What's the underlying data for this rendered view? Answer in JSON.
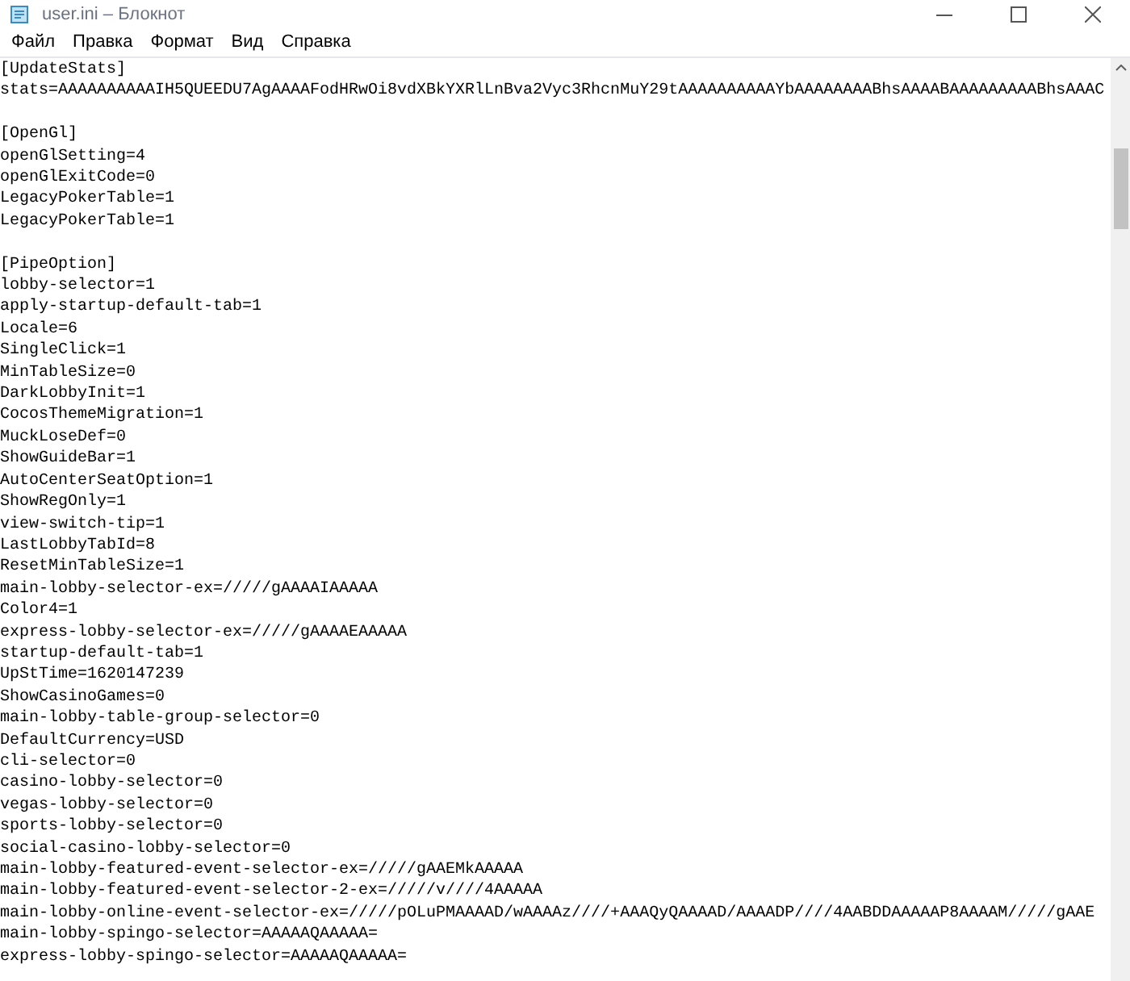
{
  "window": {
    "title": "user.ini – Блокнот"
  },
  "menu": [
    "Файл",
    "Правка",
    "Формат",
    "Вид",
    "Справка"
  ],
  "sections": [
    {
      "header": "[UpdateStats]",
      "lines": [
        "stats=AAAAAAAAAAIH5QUEEDU7AgAAAAFodHRwOi8vdXBkYXRlLnBva2Vyc3RhcnMuY29tAAAAAAAAAAYbAAAAAAAABhsAAAABAAAAAAAAABhsAAAC"
      ]
    },
    {
      "header": "[OpenGl]",
      "lines": [
        "openGlSetting=4",
        "openGlExitCode=0",
        "LegacyPokerTable=1",
        "LegacyPokerTable=1"
      ]
    },
    {
      "header": "[PipeOption]",
      "lines": [
        "lobby-selector=1",
        "apply-startup-default-tab=1",
        "Locale=6",
        "SingleClick=1",
        "MinTableSize=0",
        "DarkLobbyInit=1",
        "CocosThemeMigration=1",
        "MuckLoseDef=0",
        "ShowGuideBar=1",
        "AutoCenterSeatOption=1",
        "ShowRegOnly=1",
        "view-switch-tip=1",
        "LastLobbyTabId=8",
        "ResetMinTableSize=1",
        "main-lobby-selector-ex=/////gAAAAIAAAAA",
        "Color4=1",
        "express-lobby-selector-ex=/////gAAAAEAAAAA",
        "startup-default-tab=1",
        "UpStTime=1620147239",
        "ShowCasinoGames=0",
        "main-lobby-table-group-selector=0",
        "DefaultCurrency=USD",
        "cli-selector=0",
        "casino-lobby-selector=0",
        "vegas-lobby-selector=0",
        "sports-lobby-selector=0",
        "social-casino-lobby-selector=0",
        "main-lobby-featured-event-selector-ex=/////gAAEMkAAAAA",
        "main-lobby-featured-event-selector-2-ex=/////v////4AAAAA",
        "main-lobby-online-event-selector-ex=/////pOLuPMAAAAD/wAAAAz////+AAAQyQAAAAD/AAAADP////4AABDDAAAAAP8AAAAM/////gAAE",
        "main-lobby-spingo-selector=AAAAAQAAAAA=",
        "express-lobby-spingo-selector=AAAAAQAAAAA="
      ]
    }
  ]
}
